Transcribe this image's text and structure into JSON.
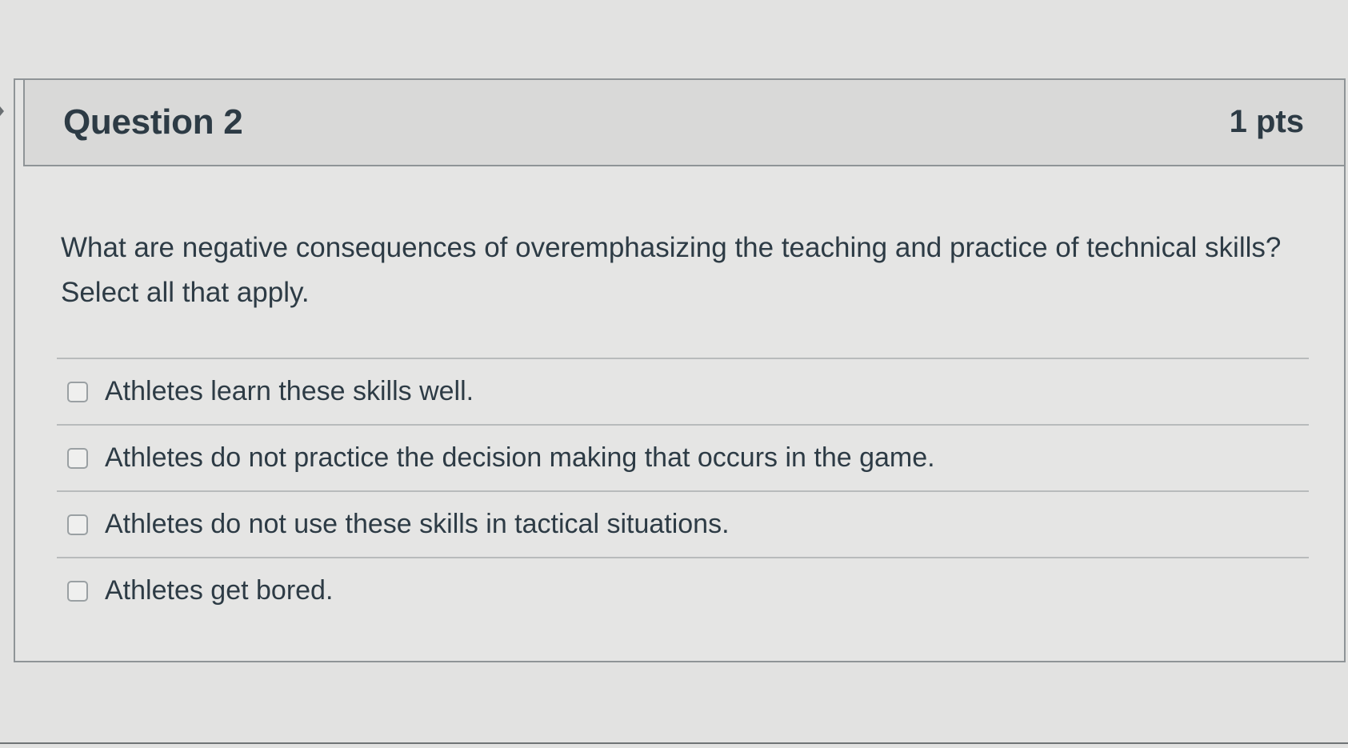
{
  "question": {
    "title": "Question 2",
    "points": "1 pts",
    "text": "What are negative consequences of overemphasizing the teaching and practice of technical skills? Select all that apply.",
    "answers": [
      {
        "label": "Athletes learn these skills well.",
        "checked": false
      },
      {
        "label": "Athletes do not practice the decision making that occurs in the game.",
        "checked": false
      },
      {
        "label": "Athletes do not use these skills in tactical situations.",
        "checked": false
      },
      {
        "label": "Athletes get bored.",
        "checked": false
      }
    ]
  },
  "colors": {
    "background": "#e2e2e1",
    "header_background": "#d9d9d8",
    "text": "#2d3b45",
    "border": "#8f9497"
  }
}
